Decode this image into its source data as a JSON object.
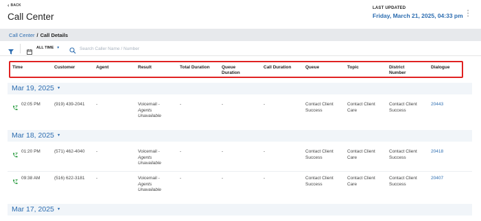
{
  "header": {
    "back_label": "BACK",
    "title": "Call Center",
    "last_updated_label": "LAST UPDATED",
    "last_updated_value": "Friday, March 21, 2025, 04:33 pm"
  },
  "breadcrumb": {
    "parent": "Call Center",
    "separator": "/",
    "current": "Call Details"
  },
  "toolbar": {
    "time_filter": "ALL TIME",
    "search_placeholder": "Search Caller Name / Number"
  },
  "columns": [
    {
      "id": "time",
      "label": "Time"
    },
    {
      "id": "customer",
      "label": "Customer"
    },
    {
      "id": "agent",
      "label": "Agent"
    },
    {
      "id": "result",
      "label": "Result"
    },
    {
      "id": "total_duration",
      "label": "Total Duration"
    },
    {
      "id": "queue_duration",
      "label": "Queue Duration"
    },
    {
      "id": "call_duration",
      "label": "Call Duration"
    },
    {
      "id": "queue",
      "label": "Queue"
    },
    {
      "id": "topic",
      "label": "Topic"
    },
    {
      "id": "district_number",
      "label": "District Number"
    },
    {
      "id": "dialogue",
      "label": "Dialogue"
    }
  ],
  "groups": [
    {
      "date": "Mar 19, 2025",
      "rows": [
        {
          "time": "02:05 PM",
          "customer": "(919) 439-2041",
          "agent": "-",
          "result_line1": "Voicemail -",
          "result_line2": "Agents",
          "result_line3": "Unavailable",
          "total_duration": "-",
          "queue_duration": "-",
          "call_duration": "-",
          "queue_line1": "Contact Client",
          "queue_line2": "Success",
          "topic_line1": "Contact Client",
          "topic_line2": "Care",
          "district_line1": "Contact Client",
          "district_line2": "Success",
          "dialogue": "20443"
        }
      ]
    },
    {
      "date": "Mar 18, 2025",
      "rows": [
        {
          "time": "01:20 PM",
          "customer": "(571) 462-4040",
          "agent": "-",
          "result_line1": "Voicemail -",
          "result_line2": "Agents",
          "result_line3": "Unavailable",
          "total_duration": "-",
          "queue_duration": "-",
          "call_duration": "-",
          "queue_line1": "Contact Client",
          "queue_line2": "Success",
          "topic_line1": "Contact Client",
          "topic_line2": "Care",
          "district_line1": "Contact Client",
          "district_line2": "Success",
          "dialogue": "20418"
        },
        {
          "time": "09:38 AM",
          "customer": "(516) 622-3181",
          "agent": "-",
          "result_line1": "Voicemail -",
          "result_line2": "Agents",
          "result_line3": "Unavailable",
          "total_duration": "-",
          "queue_duration": "-",
          "call_duration": "-",
          "queue_line1": "Contact Client",
          "queue_line2": "Success",
          "topic_line1": "Contact Client",
          "topic_line2": "Care",
          "district_line1": "Contact Client",
          "district_line2": "Success",
          "dialogue": "20407"
        }
      ]
    },
    {
      "date": "Mar 17, 2025",
      "rows": []
    }
  ],
  "icons": {
    "back": "chevron-left-icon",
    "filter": "filter-icon",
    "calendar": "calendar-icon",
    "search": "search-icon",
    "phone": "phone-incoming-icon",
    "menu": "kebab-menu-icon"
  },
  "colors": {
    "accent": "#2b6cb0",
    "highlight_border": "#e02020",
    "phone_icon": "#2e9e44",
    "date_band": "#f1f5f9",
    "breadcrumb_bar": "#e7e9ec"
  }
}
